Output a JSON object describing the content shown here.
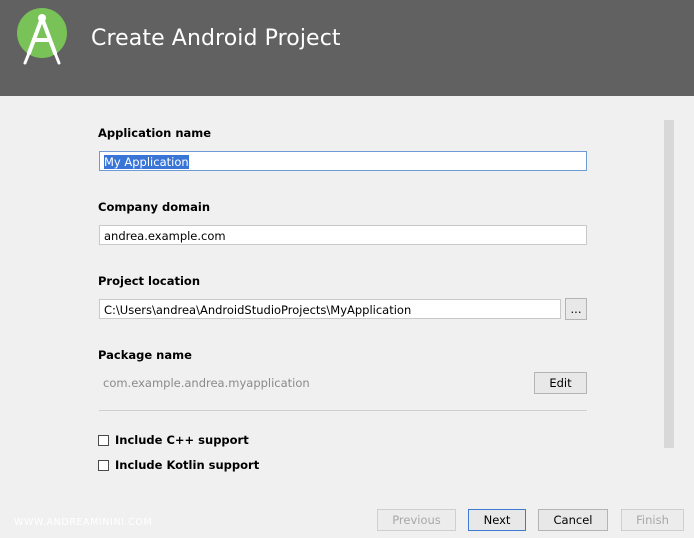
{
  "header": {
    "title": "Create Android Project"
  },
  "form": {
    "app_name": {
      "label": "Application name",
      "value": "My Application"
    },
    "company_domain": {
      "label": "Company domain",
      "value": "andrea.example.com"
    },
    "project_location": {
      "label": "Project location",
      "value": "C:\\Users\\andrea\\AndroidStudioProjects\\MyApplication",
      "browse_label": "..."
    },
    "package_name": {
      "label": "Package name",
      "value": "com.example.andrea.myapplication",
      "edit_label": "Edit"
    },
    "cpp_support": {
      "label": "Include C++ support",
      "checked": false
    },
    "kotlin_support": {
      "label": "Include Kotlin support",
      "checked": false
    }
  },
  "footer": {
    "watermark": "WWW.ANDREAMININI.COM",
    "previous_label": "Previous",
    "next_label": "Next",
    "cancel_label": "Cancel",
    "finish_label": "Finish"
  },
  "colors": {
    "header_bg": "#616161",
    "logo_green": "#78c257",
    "selection": "#3875d7"
  },
  "icons": {
    "logo": "android-studio-logo-icon"
  }
}
